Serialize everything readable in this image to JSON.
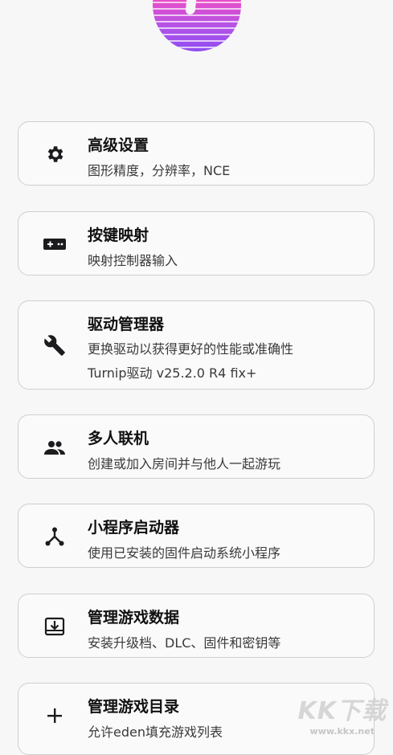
{
  "items": [
    {
      "title": "高级设置",
      "subtitle": "图形精度，分辨率，NCE",
      "icon": "gear-icon"
    },
    {
      "title": "按键映射",
      "subtitle": "映射控制器输入",
      "icon": "gamepad-icon"
    },
    {
      "title": "驱动管理器",
      "subtitle": "更换驱动以获得更好的性能或准确性",
      "detail": "Turnip驱动  v25.2.0  R4  fix+",
      "icon": "wrench-icon"
    },
    {
      "title": "多人联机",
      "subtitle": "创建或加入房间并与他人一起游玩",
      "icon": "people-icon"
    },
    {
      "title": "小程序启动器",
      "subtitle": "使用已安装的固件启动系统小程序",
      "icon": "hub-icon"
    },
    {
      "title": "管理游戏数据",
      "subtitle": "安装升级档、DLC、固件和密钥等",
      "icon": "download-box-icon"
    },
    {
      "title": "管理游戏目录",
      "subtitle": "允许eden填充游戏列表",
      "icon": "plus-icon"
    }
  ],
  "watermark": {
    "text": "KK下载",
    "url": "www.kkx.net"
  }
}
